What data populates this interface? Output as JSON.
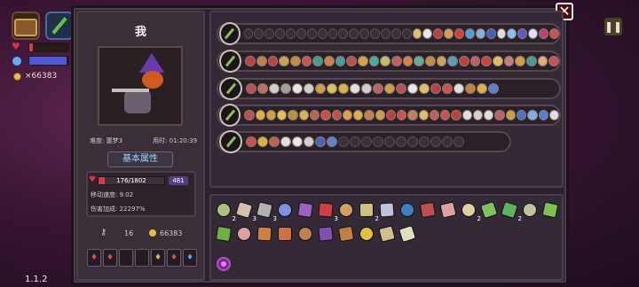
{
  "hud": {
    "gold_text": "×66383",
    "hp_fill": 0.1,
    "mp_fill": 0.95,
    "colors": {
      "hp": "#d83a4a",
      "mp": "#4a5ad8",
      "gold": "#e8c040"
    }
  },
  "version": "1.1.2",
  "panel": {
    "player_name": "我",
    "difficulty": "难度: 噩梦3",
    "time_used": "用时: 01:20:39",
    "stats_button": "基本属性",
    "hp_value": "176/1802",
    "hp_fill": 0.098,
    "shield_value": "481",
    "move_speed": "移动速度: 9.02",
    "damage_bonus": "伤害加成: 22297%",
    "keys": "16",
    "coins": "66383"
  },
  "weapon_rows": [
    {
      "weapon_icon": "chest-icon",
      "filled": 14,
      "total": 30,
      "empty_first": true,
      "colors": [
        "#e0c070",
        "#e8e8e8",
        "#c04040",
        "#d0a050",
        "#d04040",
        "#4aa0e0",
        "#80b0e0",
        "#4060c0",
        "#e0e0e0",
        "#80c0ff",
        "#5a5ad0",
        "#e0e0ff",
        "#c04070",
        "#d05050"
      ]
    },
    {
      "weapon_icon": "staff-icon",
      "filled": 28,
      "total": 28,
      "empty_first": false,
      "colors": [
        "#c04040",
        "#c0804a",
        "#c04040",
        "#d0a050",
        "#c09040",
        "#d05050",
        "#40a090",
        "#d08040",
        "#40a0a0",
        "#c05050",
        "#e0a040",
        "#40b0a0",
        "#c0c060",
        "#c06060",
        "#e08040",
        "#60b090",
        "#c09040",
        "#d0a060",
        "#50a0c0",
        "#c04040",
        "#c06060",
        "#d04040",
        "#e0c060",
        "#c08080",
        "#d0a040",
        "#40a090",
        "#e0b070",
        "#d05050"
      ]
    },
    {
      "weapon_icon": "bow-icon",
      "filled": 22,
      "total": 22,
      "empty_first": false,
      "colors": [
        "#c05050",
        "#c07060",
        "#d0d0d0",
        "#a0a0a0",
        "#e8e8e8",
        "#d0d0d0",
        "#d0a040",
        "#e0c050",
        "#e0b040",
        "#e0e0e0",
        "#d0d0d0",
        "#c06060",
        "#d0a040",
        "#c05050",
        "#e8e8e8",
        "#e0c060",
        "#c04040",
        "#d05050",
        "#e0e0e0",
        "#c08040",
        "#e0b040",
        "#5080e0"
      ]
    },
    {
      "weapon_icon": "wand-icon",
      "filled": 29,
      "total": 29,
      "empty_first": false,
      "colors": [
        "#c05050",
        "#e0b040",
        "#d0a040",
        "#e0c050",
        "#c09040",
        "#e0b050",
        "#c06050",
        "#d05040",
        "#c05050",
        "#e0a040",
        "#e0b040",
        "#c08050",
        "#d0a040",
        "#c04040",
        "#d05050",
        "#c08060",
        "#e0c060",
        "#c06060",
        "#d05050",
        "#c04040",
        "#e0e0e0",
        "#d0d0d0",
        "#e0e0e0",
        "#c06060",
        "#d0a040",
        "#4a70d0",
        "#80b0e0",
        "#5080e0",
        "#e0e0e0"
      ]
    },
    {
      "weapon_icon": "trident-icon",
      "filled": 8,
      "total": 19,
      "empty_first": false,
      "colors": [
        "#d05050",
        "#e0b040",
        "#c06050",
        "#e0e0e0",
        "#e8e8e8",
        "#d0d0d0",
        "#5060c0",
        "#6080d0"
      ]
    }
  ],
  "inventory": [
    {
      "icon": "boot-icon",
      "color": "#b0c080",
      "count": "2"
    },
    {
      "icon": "feather-icon",
      "color": "#d0c0b0",
      "count": "3"
    },
    {
      "icon": "claw-icon",
      "color": "#b0b0b0",
      "count": "3"
    },
    {
      "icon": "crystal-icon",
      "color": "#8090e0",
      "count": ""
    },
    {
      "icon": "shield-icon",
      "color": "#a060c0",
      "count": ""
    },
    {
      "icon": "demon-icon",
      "color": "#d04040",
      "count": "3"
    },
    {
      "icon": "fist-icon",
      "color": "#d0a060",
      "count": ""
    },
    {
      "icon": "scroll-icon",
      "color": "#d0c080",
      "count": "2"
    },
    {
      "icon": "gem-icon",
      "color": "#c0c0e0",
      "count": ""
    },
    {
      "icon": "flask-icon",
      "color": "#4080c0",
      "count": ""
    },
    {
      "icon": "horn-icon",
      "color": "#c05050",
      "count": ""
    },
    {
      "icon": "egg-icon",
      "color": "#e0a0a0",
      "count": ""
    },
    {
      "icon": "cheese-icon",
      "color": "#e0d0a0",
      "count": "2"
    },
    {
      "icon": "leaf-icon",
      "color": "#80c060",
      "count": ""
    },
    {
      "icon": "hook-icon",
      "color": "#60b060",
      "count": "2"
    },
    {
      "icon": "tile-icon",
      "color": "#c0c0a0",
      "count": ""
    },
    {
      "icon": "herb-icon",
      "color": "#80c050",
      "count": ""
    },
    {
      "icon": "vine-icon",
      "color": "#70b040",
      "count": ""
    },
    {
      "icon": "bread-icon",
      "color": "#e0a0a0",
      "count": ""
    },
    {
      "icon": "chain-icon",
      "color": "#d08040",
      "count": ""
    },
    {
      "icon": "rune-icon",
      "color": "#d07040",
      "count": ""
    },
    {
      "icon": "gauntlet-icon",
      "color": "#c08050",
      "count": ""
    },
    {
      "icon": "hat-icon",
      "color": "#8050b0",
      "count": ""
    },
    {
      "icon": "pickaxe-icon",
      "color": "#c08040",
      "count": ""
    },
    {
      "icon": "teeth-icon",
      "color": "#e0c040",
      "count": ""
    },
    {
      "icon": "bag-icon",
      "color": "#d0c090",
      "count": ""
    },
    {
      "icon": "duck-icon",
      "color": "#e0e0c0",
      "count": ""
    }
  ]
}
